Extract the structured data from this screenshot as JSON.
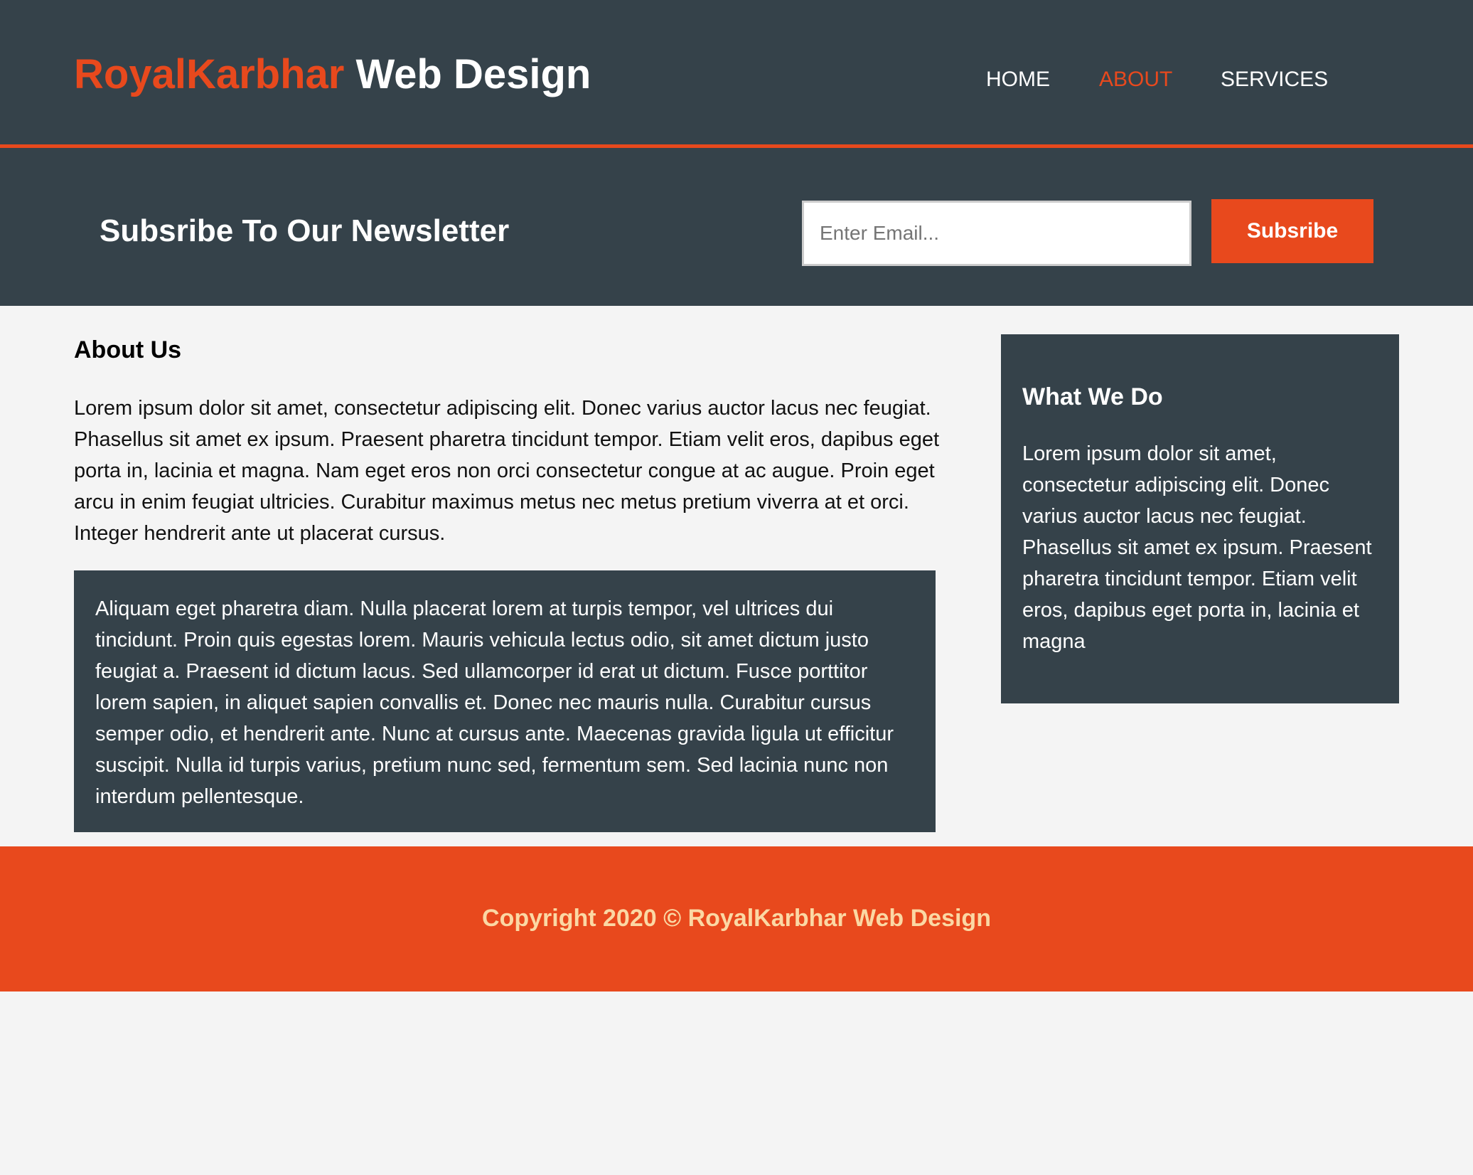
{
  "header": {
    "brand_highlight": "RoyalKarbhar",
    "brand_rest": " Web Design",
    "nav": [
      {
        "label": "Home",
        "current": false
      },
      {
        "label": "About",
        "current": true
      },
      {
        "label": "Services",
        "current": false
      }
    ]
  },
  "newsletter": {
    "title": "Subsribe To Our Newsletter",
    "email_placeholder": "Enter Email...",
    "button_label": "Subsribe"
  },
  "main": {
    "title": "About Us",
    "intro": "Lorem ipsum dolor sit amet, consectetur adipiscing elit. Donec varius auctor lacus nec feugiat. Phasellus sit amet ex ipsum. Praesent pharetra tincidunt tempor. Etiam velit eros, dapibus eget porta in, lacinia et magna. Nam eget eros non orci consectetur congue at ac augue. Proin eget arcu in enim feugiat ultricies. Curabitur maximus metus nec metus pretium viverra at et orci. Integer hendrerit ante ut placerat cursus.",
    "dark_text": "Aliquam eget pharetra diam. Nulla placerat lorem at turpis tempor, vel ultrices dui tincidunt. Proin quis egestas lorem. Mauris vehicula lectus odio, sit amet dictum justo feugiat a. Praesent id dictum lacus. Sed ullamcorper id erat ut dictum. Fusce porttitor lorem sapien, in aliquet sapien convallis et. Donec nec mauris nulla. Curabitur cursus semper odio, et hendrerit ante. Nunc at cursus ante. Maecenas gravida ligula ut efficitur suscipit. Nulla id turpis varius, pretium nunc sed, fermentum sem. Sed lacinia nunc non interdum pellentesque."
  },
  "sidebar": {
    "title": "What We Do",
    "text": "Lorem ipsum dolor sit amet, consectetur adipiscing elit. Donec varius auctor lacus nec feugiat. Phasellus sit amet ex ipsum. Praesent pharetra tincidunt tempor. Etiam velit eros, dapibus eget porta in, lacinia et magna"
  },
  "footer": {
    "copyright": "Copyright 2020 © RoyalKarbhar Web Design"
  },
  "colors": {
    "dark": "#35424a",
    "accent": "#e8491d",
    "footer_text": "#fbd8a4",
    "background": "#f4f4f4"
  }
}
